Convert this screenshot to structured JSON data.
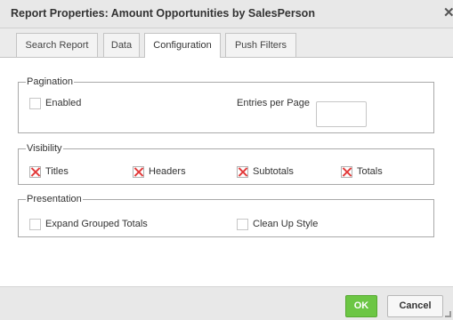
{
  "dialog": {
    "title": "Report Properties: Amount Opportunities by SalesPerson",
    "close_glyph": "✕"
  },
  "tabs": [
    {
      "label": "Search Report",
      "active": false
    },
    {
      "label": "Data",
      "active": false
    },
    {
      "label": "Configuration",
      "active": true
    },
    {
      "label": "Push Filters",
      "active": false
    }
  ],
  "pagination": {
    "legend": "Pagination",
    "enabled": {
      "label": "Enabled",
      "checked": false
    },
    "entries_label": "Entries per Page",
    "entries_value": ""
  },
  "visibility": {
    "legend": "Visibility",
    "items": [
      {
        "label": "Titles",
        "checked": true
      },
      {
        "label": "Headers",
        "checked": true
      },
      {
        "label": "Subtotals",
        "checked": true
      },
      {
        "label": "Totals",
        "checked": true
      }
    ]
  },
  "presentation": {
    "legend": "Presentation",
    "items": [
      {
        "label": "Expand Grouped Totals",
        "checked": false
      },
      {
        "label": "Clean Up Style",
        "checked": false
      }
    ]
  },
  "footer": {
    "ok_label": "OK",
    "cancel_label": "Cancel"
  },
  "colors": {
    "ok_button": "#6cc644",
    "checked_mark": "#e23b3b",
    "titlebar": "#e8e8e8"
  }
}
